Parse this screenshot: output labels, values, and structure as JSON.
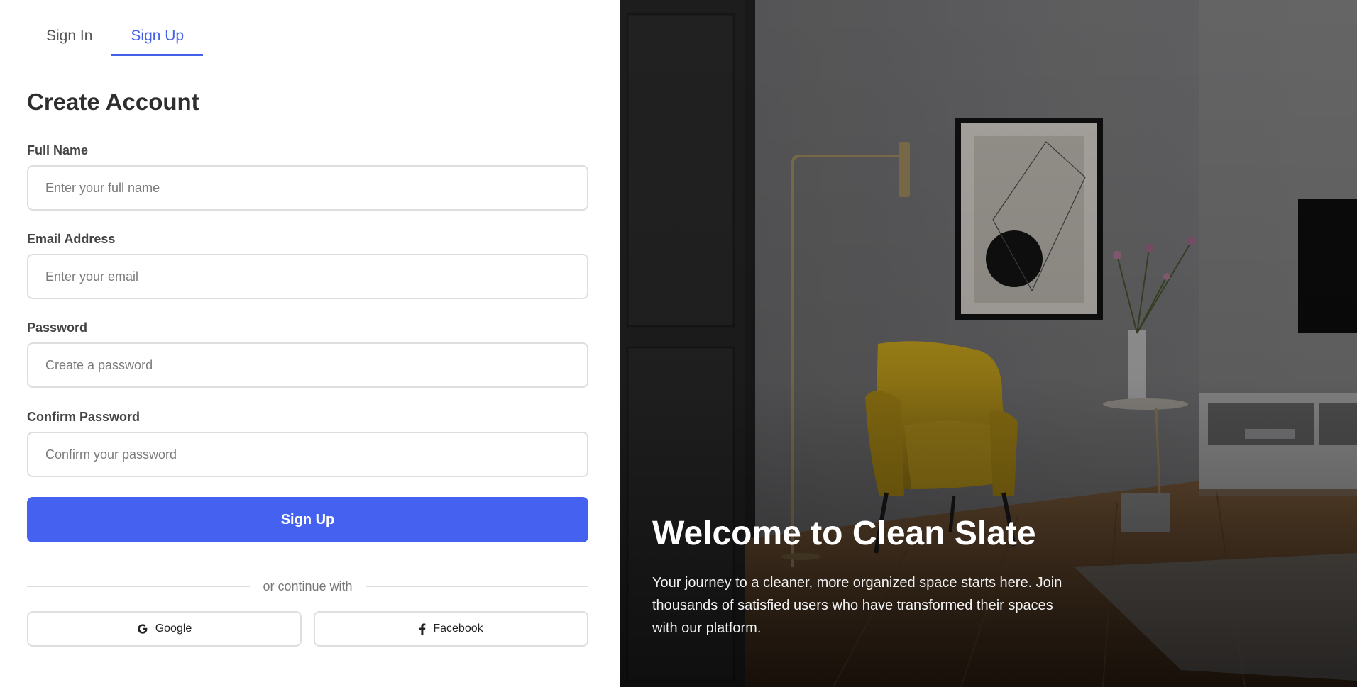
{
  "tabs": [
    {
      "label": "Sign In",
      "active": false
    },
    {
      "label": "Sign Up",
      "active": true
    }
  ],
  "form": {
    "title": "Create Account",
    "fields": [
      {
        "label": "Full Name",
        "placeholder": "Enter your full name",
        "value": ""
      },
      {
        "label": "Email Address",
        "placeholder": "Enter your email",
        "value": ""
      },
      {
        "label": "Password",
        "placeholder": "Create a password",
        "value": ""
      },
      {
        "label": "Confirm Password",
        "placeholder": "Confirm your password",
        "value": ""
      }
    ],
    "submit_label": "Sign Up",
    "divider_text": "or continue with",
    "social": [
      {
        "label": "Google",
        "icon": "google-icon"
      },
      {
        "label": "Facebook",
        "icon": "facebook-icon"
      }
    ]
  },
  "hero": {
    "title": "Welcome to Clean Slate",
    "text": "Your journey to a cleaner, more organized space starts here. Join thousands of satisfied users who have transformed their spaces with our platform."
  },
  "colors": {
    "accent": "#4461ea",
    "button": "#4561ef",
    "border": "#dedede"
  }
}
